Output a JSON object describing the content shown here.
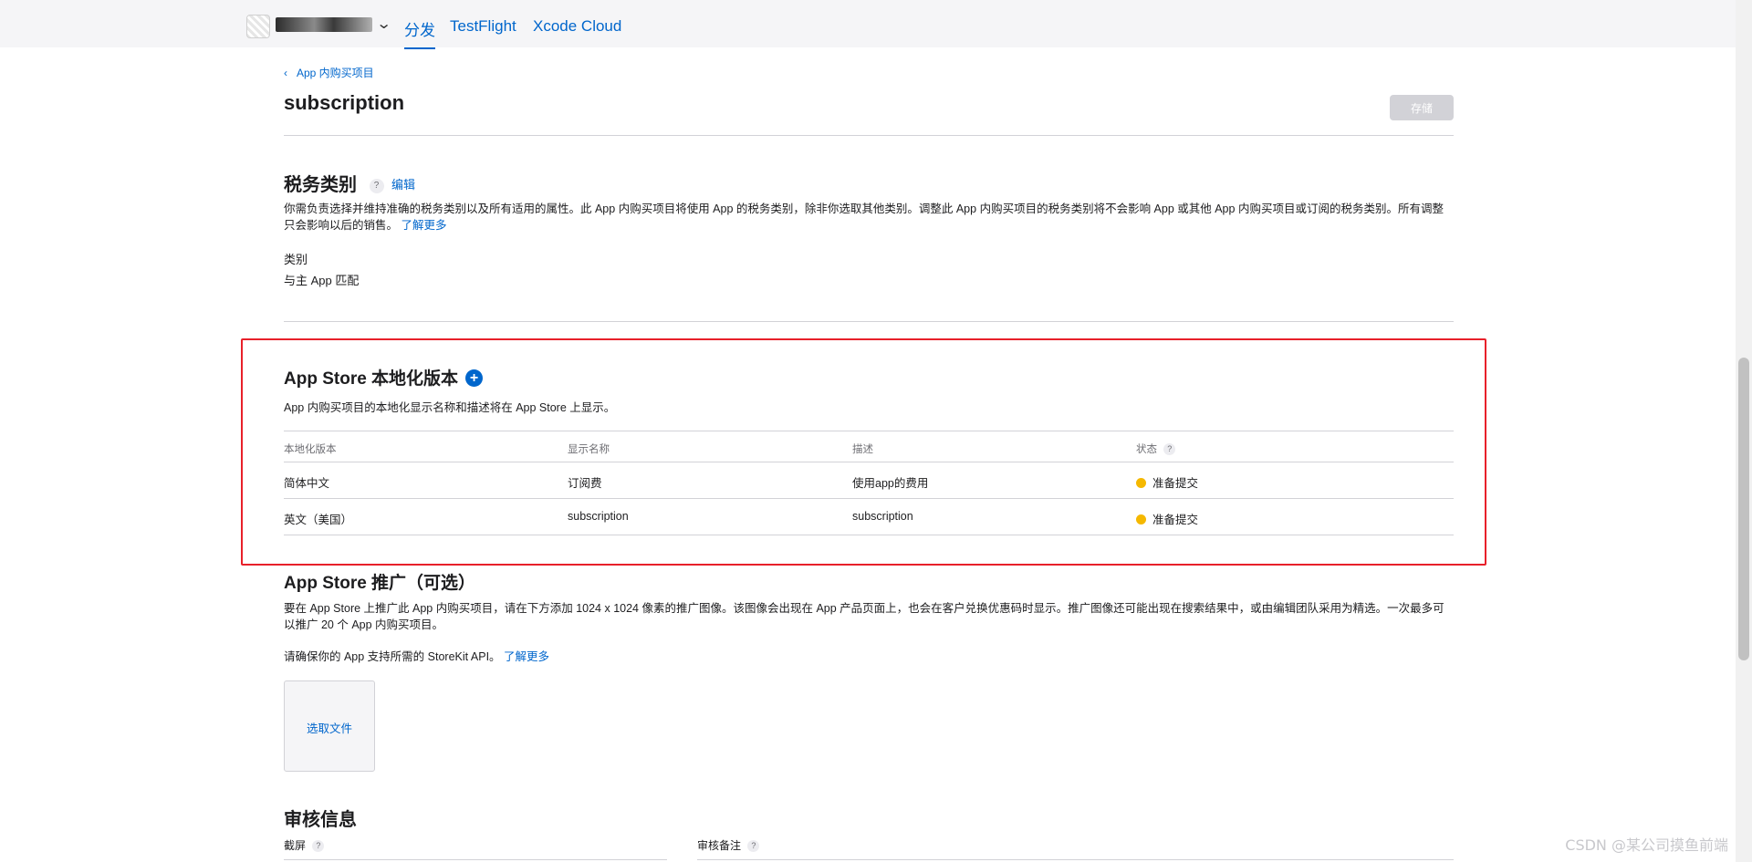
{
  "header": {
    "app_icon": "app-icon",
    "chevron": "⌄",
    "tabs": [
      {
        "label": "分发",
        "active": true
      },
      {
        "label": "TestFlight",
        "active": false
      },
      {
        "label": "Xcode Cloud",
        "active": false
      }
    ]
  },
  "breadcrumb": {
    "chevron": "‹",
    "label": "App 内购买项目"
  },
  "page": {
    "title": "subscription",
    "save_label": "存储"
  },
  "tax": {
    "title": "税务类别",
    "help": "?",
    "edit": "编辑",
    "description": "你需负责选择并维持准确的税务类别以及所有适用的属性。此 App 内购买项目将使用 App 的税务类别，除非你选取其他类别。调整此 App 内购买项目的税务类别将不会影响 App 或其他 App 内购买项目或订阅的税务类别。所有调整只会影响以后的销售。",
    "learn_more": "了解更多",
    "category_label": "类别",
    "category_value": "与主 App 匹配"
  },
  "localization": {
    "title": "App Store 本地化版本",
    "add_icon": "+",
    "description": "App 内购买项目的本地化显示名称和描述将在 App Store 上显示。",
    "columns": [
      "本地化版本",
      "显示名称",
      "描述",
      "状态"
    ],
    "status_help": "?",
    "rows": [
      {
        "locale": "简体中文",
        "name": "订阅费",
        "description": "使用app的费用",
        "status": "准备提交"
      },
      {
        "locale": "英文（美国）",
        "name": "subscription",
        "description": "subscription",
        "status": "准备提交"
      }
    ]
  },
  "promotion": {
    "title": "App Store 推广（可选）",
    "description": "要在 App Store 上推广此 App 内购买项目，请在下方添加 1024 x 1024 像素的推广图像。该图像会出现在 App 产品页面上，也会在客户兑换优惠码时显示。推广图像还可能出现在搜索结果中，或由编辑团队采用为精选。一次最多可以推广 20 个 App 内购买项目。",
    "storekit_note": "请确保你的 App 支持所需的 StoreKit API。",
    "learn_more": "了解更多",
    "choose_file": "选取文件"
  },
  "review": {
    "title": "审核信息",
    "screenshot_label": "截屏",
    "notes_label": "审核备注",
    "help": "?"
  },
  "watermark": "CSDN @某公司摸鱼前端",
  "colors": {
    "accent": "#0066cc",
    "highlight": "#e8202a",
    "status_pending": "#f5b800"
  }
}
